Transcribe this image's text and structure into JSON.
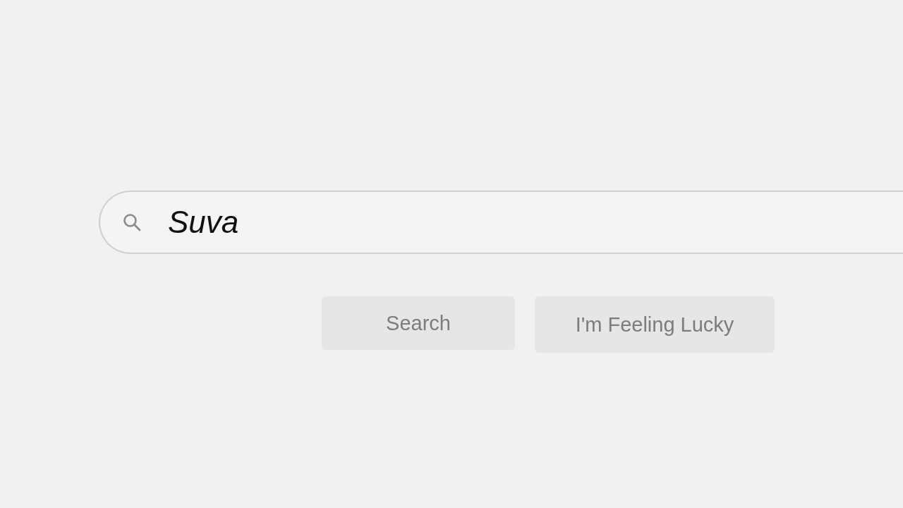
{
  "search_bar": {
    "value": "Suva"
  },
  "buttons": [
    {
      "label": "Search"
    },
    {
      "label": "I'm Feeling Lucky"
    }
  ]
}
